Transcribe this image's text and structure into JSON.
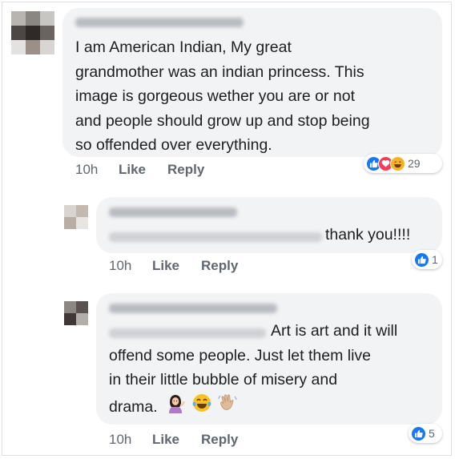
{
  "comments": [
    {
      "lines": [
        "I am American Indian,  My great",
        "grandmother was an indian princess. This",
        "image is gorgeous wether you are or not",
        "and people should grow up and stop being",
        "so offended over everything."
      ],
      "time": "10h",
      "like_label": "Like",
      "reply_label": "Reply",
      "reactions": [
        "like",
        "love",
        "haha"
      ],
      "reaction_count": "29"
    },
    {
      "lines": [
        "thank you!!!!"
      ],
      "time": "10h",
      "like_label": "Like",
      "reply_label": "Reply",
      "reactions": [
        "like"
      ],
      "reaction_count": "1"
    },
    {
      "lines": [
        "Art is art and it will",
        "offend some people. Just let them live",
        "in their little bubble of misery and",
        "drama."
      ],
      "emoji": [
        "woman-tipping-hand",
        "face-with-tears-of-joy",
        "waving-hand"
      ],
      "time": "10h",
      "like_label": "Like",
      "reply_label": "Reply",
      "reactions": [
        "like"
      ],
      "reaction_count": "5"
    }
  ],
  "colors": {
    "bubble": "#f2f3f5",
    "like_blue": "#1877f2",
    "love_red": "#f33e58",
    "haha_yellow": "#f7b125",
    "meta_gray": "#606770"
  }
}
